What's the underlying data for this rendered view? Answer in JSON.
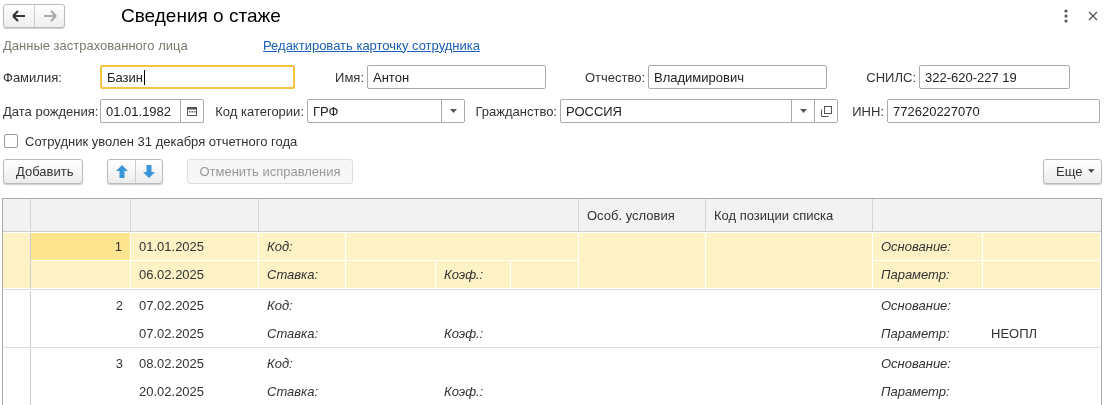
{
  "nav": [
    {
      "kind": "back",
      "disabled": false
    },
    {
      "kind": "forward",
      "disabled": true
    }
  ],
  "title": "Сведения о стаже",
  "section_label": "Данные застрахованного лица",
  "edit_link": "Редактировать карточку сотрудника",
  "field_rows": [
    [
      {
        "label": "Фамилия:",
        "value": "Базин",
        "kind": "text",
        "focused": true
      },
      {
        "label": "Имя:",
        "value": "Антон",
        "kind": "text",
        "focused": false
      },
      {
        "label": "Отчество:",
        "value": "Владимирович",
        "kind": "text",
        "focused": false
      },
      {
        "label": "СНИЛС:",
        "value": "322-620-227 19",
        "kind": "text",
        "focused": false
      }
    ],
    [
      {
        "label": "Дата рождения:",
        "value": "01.01.1982",
        "kind": "date",
        "focused": false
      },
      {
        "label": "Код категории:",
        "value": "ГРФ",
        "kind": "select",
        "focused": false
      },
      {
        "label": "Гражданство:",
        "value": "РОССИЯ",
        "kind": "select_open",
        "focused": false
      },
      {
        "label": "ИНН:",
        "value": "772620227070",
        "kind": "text",
        "focused": false
      }
    ]
  ],
  "dismissed_checkbox": {
    "label": "Сотрудник уволен 31 декабря отчетного года",
    "checked": false
  },
  "toolbar": {
    "add": "Добавить",
    "cancel": {
      "label": "Отменить исправления",
      "disabled": true
    },
    "more": "Еще"
  },
  "table": {
    "columns": [
      "Особ. условия",
      "Код позиции списка"
    ],
    "rows": [
      {
        "number": "1",
        "start": "01.01.2025",
        "end": "06.02.2025",
        "code_label": "Код:",
        "rate_label": "Ставка:",
        "coef_label": "Коэф.:",
        "basis_label": "Основание:",
        "param_label": "Параметр:",
        "selected": true
      },
      {
        "number": "2",
        "start": "07.02.2025",
        "end": "07.02.2025",
        "code_label": "Код:",
        "rate_label": "Ставка:",
        "coef_label": "Коэф.:",
        "basis_label": "Основание:",
        "param_label": "Параметр:",
        "param": "НЕОПЛ",
        "selected": false
      },
      {
        "number": "3",
        "start": "08.02.2025",
        "end": "20.02.2025",
        "code_label": "Код:",
        "rate_label": "Ставка:",
        "coef_label": "Коэф.:",
        "basis_label": "Основание:",
        "param_label": "Параметр:",
        "selected": false
      }
    ]
  }
}
